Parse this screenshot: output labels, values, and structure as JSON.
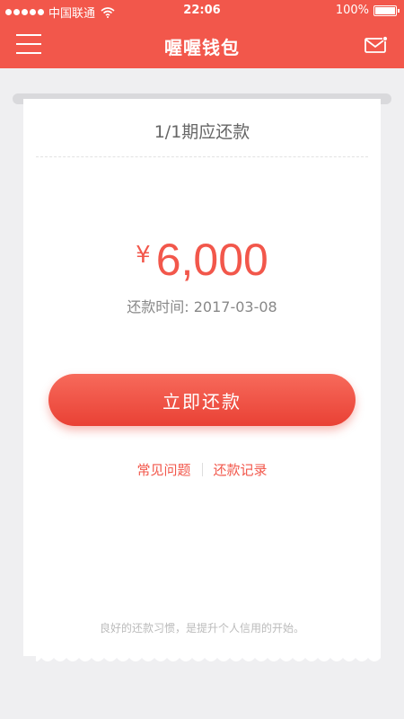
{
  "status_bar": {
    "carrier": "中国联通",
    "time": "22:06",
    "battery": "100%"
  },
  "nav": {
    "title": "喔喔钱包"
  },
  "card": {
    "period_label": "1/1期应还款",
    "currency_symbol": "¥",
    "amount": "6,000",
    "due_date_label": "还款时间:",
    "due_date": "2017-03-08",
    "repay_button_label": "立即还款",
    "faq_link": "常见问题",
    "history_link": "还款记录",
    "footer_note": "良好的还款习惯，是提升个人信用的开始。"
  },
  "colors": {
    "brand": "#f2574b",
    "background": "#efeff1"
  },
  "icons": {
    "menu": "menu-icon",
    "mail": "mail-icon",
    "wifi": "wifi-icon",
    "battery": "battery-icon"
  }
}
